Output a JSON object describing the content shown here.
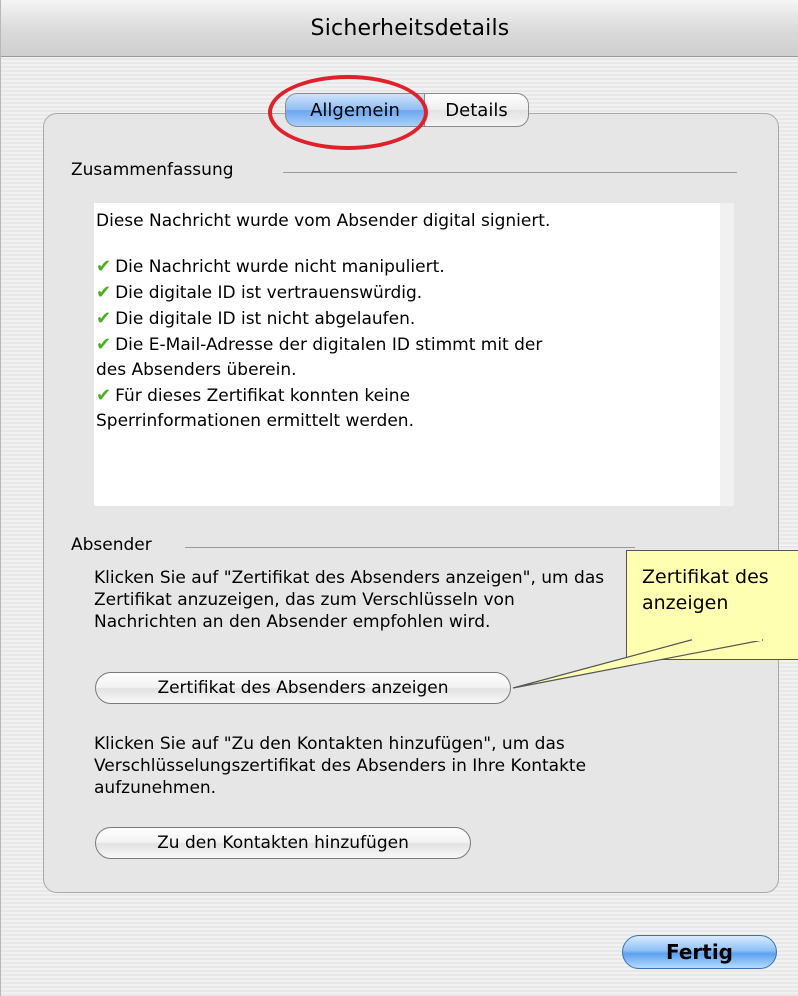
{
  "window": {
    "title": "Sicherheitsdetails"
  },
  "tabs": [
    {
      "label": "Allgemein",
      "active": true
    },
    {
      "label": "Details",
      "active": false
    }
  ],
  "summary": {
    "heading": "Zusammenfassung",
    "intro": "Diese Nachricht wurde vom Absender digital signiert.",
    "items": [
      "Die Nachricht wurde nicht manipuliert.",
      "Die digitale ID ist vertrauenswürdig.",
      "Die digitale ID ist nicht abgelaufen.",
      "Die E-Mail-Adresse der digitalen ID stimmt mit der",
      "des Absenders überein.",
      "Für dieses Zertifikat konnten keine",
      "Sperrinformationen ermittelt werden."
    ]
  },
  "sender": {
    "heading": "Absender",
    "cert_text": [
      "Klicken Sie auf \"Zertifikat des Absenders anzeigen\", um das",
      "Zertifikat anzuzeigen, das zum Verschlüsseln von",
      "Nachrichten an den Absender empfohlen wird."
    ],
    "cert_button": "Zertifikat des Absenders anzeigen",
    "contacts_text": [
      "Klicken Sie auf \"Zu den Kontakten hinzufügen\", um das",
      "Verschlüsselungszertifikat des Absenders in Ihre Kontakte",
      "aufzunehmen."
    ],
    "contacts_button": "Zu den Kontakten hinzufügen"
  },
  "done_button": "Fertig",
  "callout": {
    "lines": [
      "Zertifikat des",
      "anzeigen"
    ]
  },
  "colors": {
    "highlight": "#e0202a",
    "callout_fill": "#ffffb2",
    "check": "#4caf1f",
    "accent": "#6aa6ee"
  },
  "icons": {
    "check": "checkmark-icon"
  }
}
